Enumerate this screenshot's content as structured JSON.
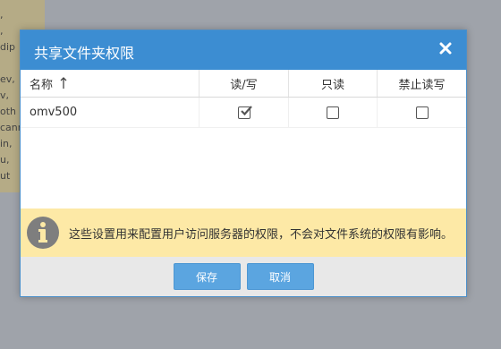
{
  "background": {
    "lines": [
      ",",
      ",",
      "dip",
      "",
      "ev,",
      "v,",
      "oth",
      "cann",
      "in,",
      "u,",
      "ut"
    ]
  },
  "dialog": {
    "title": "共享文件夹权限",
    "close_icon": "close-icon",
    "accent_color": "#3c8dd2"
  },
  "grid": {
    "headers": {
      "name": "名称",
      "read_write": "读/写",
      "read_only": "只读",
      "no_access": "禁止读写"
    },
    "sort_icon": "sort-ascending-icon",
    "rows": [
      {
        "name": "omv500",
        "read_write": true,
        "read_only": false,
        "no_access": false
      }
    ]
  },
  "info": {
    "icon": "info-icon",
    "text": "这些设置用来配置用户访问服务器的权限，不会对文件系统的权限有影响。",
    "background_color": "#fde9a6"
  },
  "footer": {
    "save_label": "保存",
    "cancel_label": "取消"
  }
}
